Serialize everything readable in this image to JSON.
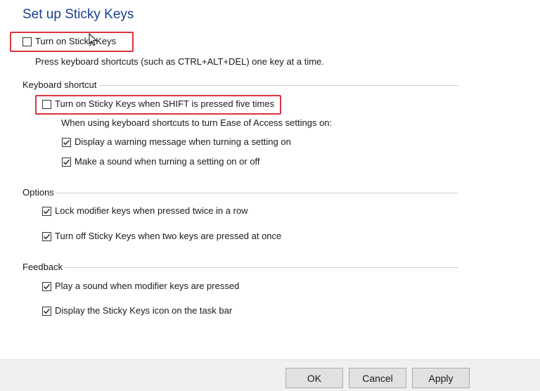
{
  "title": "Set up Sticky Keys",
  "sticky_keys": {
    "label": "Turn on Sticky Keys",
    "checked": false,
    "description": "Press keyboard shortcuts (such as CTRL+ALT+DEL) one key at a time."
  },
  "keyboard_shortcut": {
    "group_label": "Keyboard shortcut",
    "shift_label": "Turn on Sticky Keys when SHIFT is pressed five times",
    "shift_checked": false,
    "subtext": "When using keyboard shortcuts to turn Ease of Access settings on:",
    "warning_label": "Display a warning message when turning a setting on",
    "warning_checked": true,
    "sound_label": "Make a sound when turning a setting on or off",
    "sound_checked": true
  },
  "options": {
    "group_label": "Options",
    "lock_label": "Lock modifier keys when pressed twice in a row",
    "lock_checked": true,
    "turnoff_label": "Turn off Sticky Keys when two keys are pressed at once",
    "turnoff_checked": true
  },
  "feedback": {
    "group_label": "Feedback",
    "play_label": "Play a sound when modifier keys are pressed",
    "play_checked": true,
    "icon_label": "Display the Sticky Keys icon on the task bar",
    "icon_checked": true
  },
  "buttons": {
    "ok": "OK",
    "cancel": "Cancel",
    "apply": "Apply"
  },
  "colors": {
    "title": "#1b3f8f",
    "highlight": "#d9363e"
  }
}
